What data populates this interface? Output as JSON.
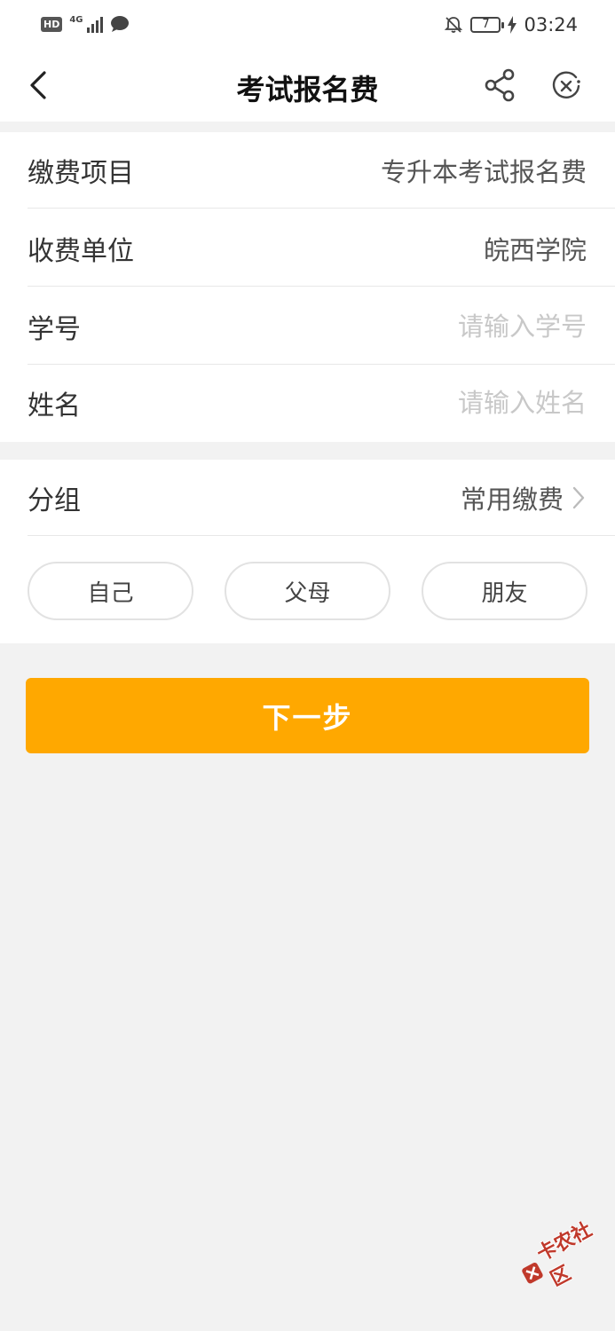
{
  "status_bar": {
    "hd": "HD",
    "network": "4G",
    "time": "03:24",
    "battery": "7"
  },
  "header": {
    "title": "考试报名费"
  },
  "icons": {
    "back": "chevron-left-icon",
    "share": "share-icon",
    "close": "close-circle-icon"
  },
  "form": {
    "rows": [
      {
        "label": "缴费项目",
        "value": "专升本考试报名费"
      },
      {
        "label": "收费单位",
        "value": "皖西学院"
      },
      {
        "label": "学号",
        "placeholder": "请输入学号"
      },
      {
        "label": "姓名",
        "placeholder": "请输入姓名"
      }
    ]
  },
  "group": {
    "label": "分组",
    "value": "常用缴费",
    "chips": [
      "自己",
      "父母",
      "朋友"
    ]
  },
  "next_button": "下一步",
  "watermark": "卡农社区",
  "colors": {
    "accent": "#ffa800",
    "background": "#f2f2f2",
    "placeholder": "#c8c8c8"
  }
}
